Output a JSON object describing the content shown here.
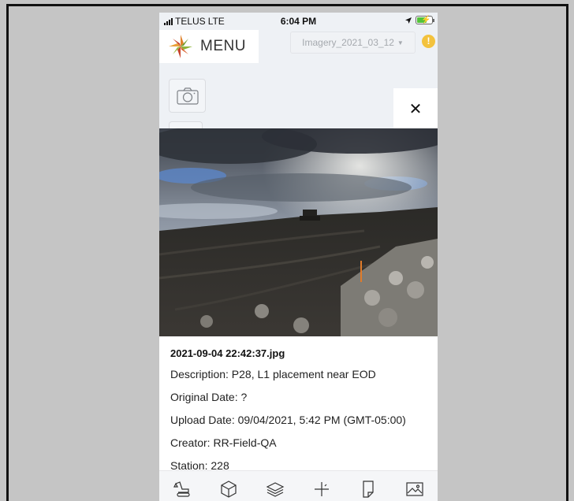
{
  "status_bar": {
    "carrier": "TELUS",
    "network": "LTE",
    "time": "6:04 PM"
  },
  "header": {
    "menu_label": "MENU",
    "imagery_select": "Imagery_2021_03_12",
    "alert_symbol": "!"
  },
  "buttons": {
    "close_symbol": "✕"
  },
  "photo_details": {
    "file_name": "2021-09-04 22:42:37.jpg",
    "description": "Description: P28, L1 placement near EOD",
    "original_date": "Original Date: ?",
    "upload_date": "Upload Date: 09/04/2021, 5:42 PM (GMT-05:00)",
    "creator": "Creator: RR-Field-QA",
    "station": "Station: 228"
  },
  "toolbar": {
    "items": [
      "excavator-icon",
      "cube-icon",
      "layers-icon",
      "crosshair-icon",
      "page-icon",
      "image-icon"
    ]
  },
  "colors": {
    "alert": "#f3c23d",
    "battery": "#52c23a",
    "logo_orange": "#e0822b",
    "logo_green": "#8fb43a",
    "logo_red": "#c8462e"
  }
}
